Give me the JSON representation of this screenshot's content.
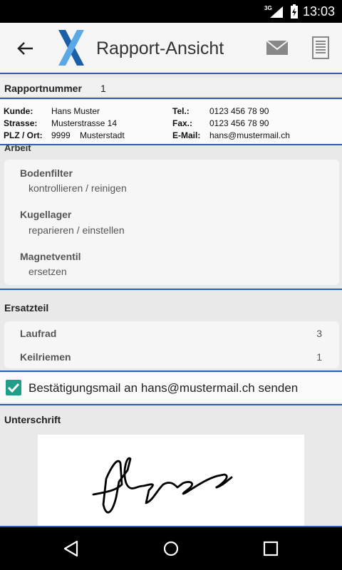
{
  "status": {
    "network": "3G",
    "time": "13:03"
  },
  "appbar": {
    "title": "Rapport-Ansicht"
  },
  "report": {
    "number_label": "Rapportnummer",
    "number_value": "1"
  },
  "customer": {
    "kunde_label": "Kunde:",
    "kunde_value": "Hans Muster",
    "strasse_label": "Strasse:",
    "strasse_value": "Musterstrasse 14",
    "plz_label": "PLZ / Ort:",
    "plz_value": "9999",
    "ort_value": "Musterstadt",
    "tel_label": "Tel.:",
    "tel_value": "0123 456 78 90",
    "fax_label": "Fax.:",
    "fax_value": "0123 456 78 90",
    "email_label": "E-Mail:",
    "email_value": "hans@mustermail.ch"
  },
  "arbeit": {
    "heading": "Arbeit",
    "items": [
      {
        "title": "Bodenfilter",
        "task": "kontrollieren / reinigen"
      },
      {
        "title": "Kugellager",
        "task": "reparieren / einstellen"
      },
      {
        "title": "Magnetventil",
        "task": "ersetzen"
      }
    ]
  },
  "ersatzteil": {
    "heading": "Ersatzteil",
    "items": [
      {
        "name": "Laufrad",
        "qty": "3"
      },
      {
        "name": "Keilriemen",
        "qty": "1"
      }
    ]
  },
  "confirmation": {
    "checked": true,
    "label": "Bestätigungsmail an hans@mustermail.ch senden"
  },
  "signature": {
    "heading": "Unterschrift"
  },
  "colors": {
    "accent": "#2a5db0",
    "checkbox": "#1f9e89",
    "logo_dark": "#1b5fa8",
    "logo_light": "#5aa9e6"
  }
}
